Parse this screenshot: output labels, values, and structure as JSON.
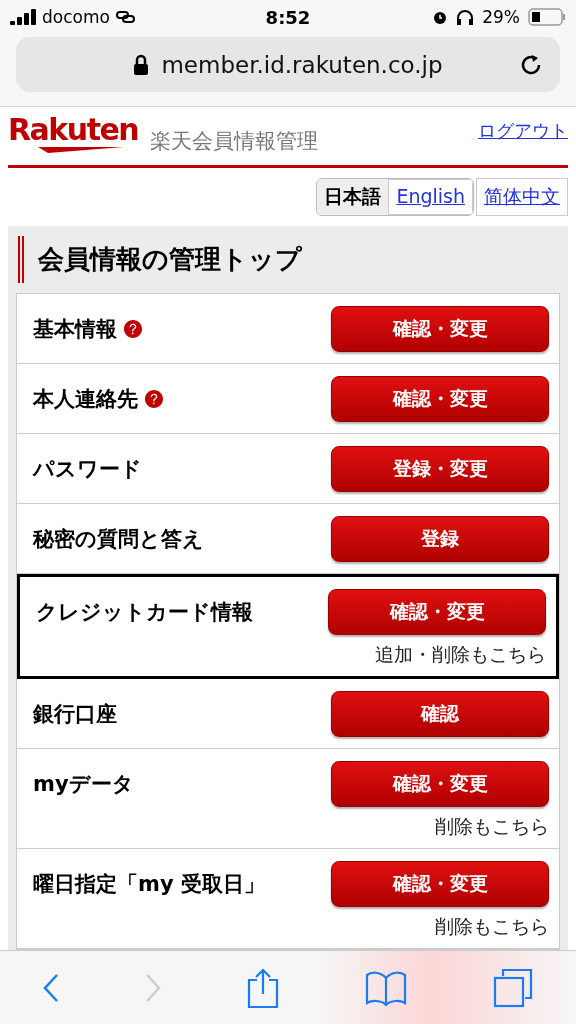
{
  "status_bar": {
    "carrier": "docomo",
    "time": "8:52",
    "battery": "29%"
  },
  "address_bar": {
    "url": "member.id.rakuten.co.jp"
  },
  "header": {
    "logo": "Rakuten",
    "title": "楽天会員情報管理",
    "logout": "ログアウト"
  },
  "languages": [
    {
      "label": "日本語",
      "selected": true
    },
    {
      "label": "English",
      "selected": false
    },
    {
      "label": "简体中文",
      "selected": false
    }
  ],
  "section_title": "会員情報の管理トップ",
  "rows": [
    {
      "label": "基本情報",
      "help": true,
      "button": "確認・変更",
      "highlighted": false
    },
    {
      "label": "本人連絡先",
      "help": true,
      "button": "確認・変更",
      "highlighted": false
    },
    {
      "label": "パスワード",
      "help": false,
      "button": "登録・変更",
      "highlighted": false
    },
    {
      "label": "秘密の質問と答え",
      "help": false,
      "button": "登録",
      "highlighted": false
    },
    {
      "label": "クレジットカード情報",
      "help": false,
      "button": "確認・変更",
      "note": "追加・削除もこちら",
      "highlighted": true
    },
    {
      "label": "銀行口座",
      "help": false,
      "button": "確認",
      "highlighted": false
    },
    {
      "label": "myデータ",
      "help": false,
      "button": "確認・変更",
      "note": "削除もこちら",
      "highlighted": false
    },
    {
      "label": "曜日指定「my 受取日」",
      "help": false,
      "button": "確認・変更",
      "note": "削除もこちら",
      "highlighted": false
    }
  ]
}
